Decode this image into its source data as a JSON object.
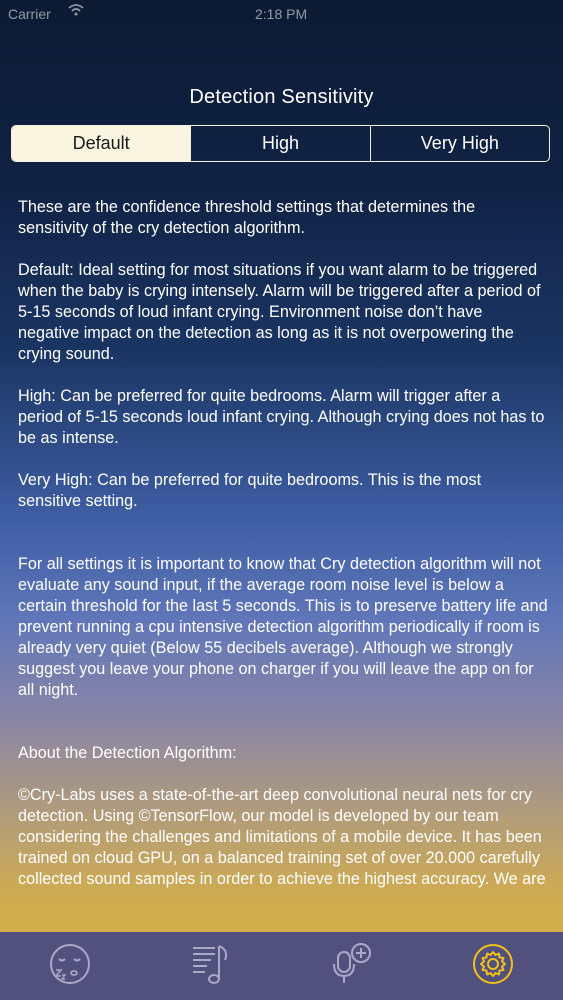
{
  "status_bar": {
    "carrier": "Carrier",
    "time": "2:18 PM"
  },
  "title": "Detection Sensitivity",
  "segments": [
    {
      "label": "Default",
      "selected": true
    },
    {
      "label": "High",
      "selected": false
    },
    {
      "label": "Very High",
      "selected": false
    }
  ],
  "paragraphs": [
    "These are the confidence threshold settings that determines the sensitivity of the cry detection algorithm.",
    "Default: Ideal setting for most situations if you want alarm to be triggered when the baby is crying intensely.  Alarm will be triggered after a period of 5-15 seconds of loud infant crying. Environment noise don’t have negative impact on the detection as long as it is not overpowering the crying sound.",
    "High: Can be preferred for quite bedrooms. Alarm will trigger after a period of 5-15 seconds loud infant crying. Although crying does not has to be as intense.",
    "Very High: Can be preferred for quite bedrooms. This is the most sensitive setting.",
    "For all settings it is important to know that Cry detection algorithm will not evaluate any sound input, if the average room noise level is below a certain threshold for the last 5 seconds. This is to preserve battery life and prevent running a cpu intensive detection algorithm periodically if room is already very quiet (Below 55 decibels average). Although we strongly suggest you leave your phone on charger if you will leave the app on for all night.",
    "About the Detection Algorithm:",
    "©Cry-Labs uses a state-of-the-art deep convolutional neural nets for cry detection. Using ©TensorFlow, our model is developed by our team considering the challenges and limitations of a mobile device. It has been trained on cloud GPU, on a balanced training set of over 20.000 carefully collected sound samples in order to achieve the highest accuracy. We are"
  ],
  "tabs": [
    {
      "icon": "sleeping-face-icon",
      "active": false
    },
    {
      "icon": "music-list-icon",
      "active": false
    },
    {
      "icon": "microphone-add-icon",
      "active": false
    },
    {
      "icon": "gear-icon",
      "active": true
    }
  ],
  "colors": {
    "active_tab": "#f2c21a",
    "inactive_tab": "#a9a9c9",
    "segment_selected_bg": "#faf5e1"
  }
}
